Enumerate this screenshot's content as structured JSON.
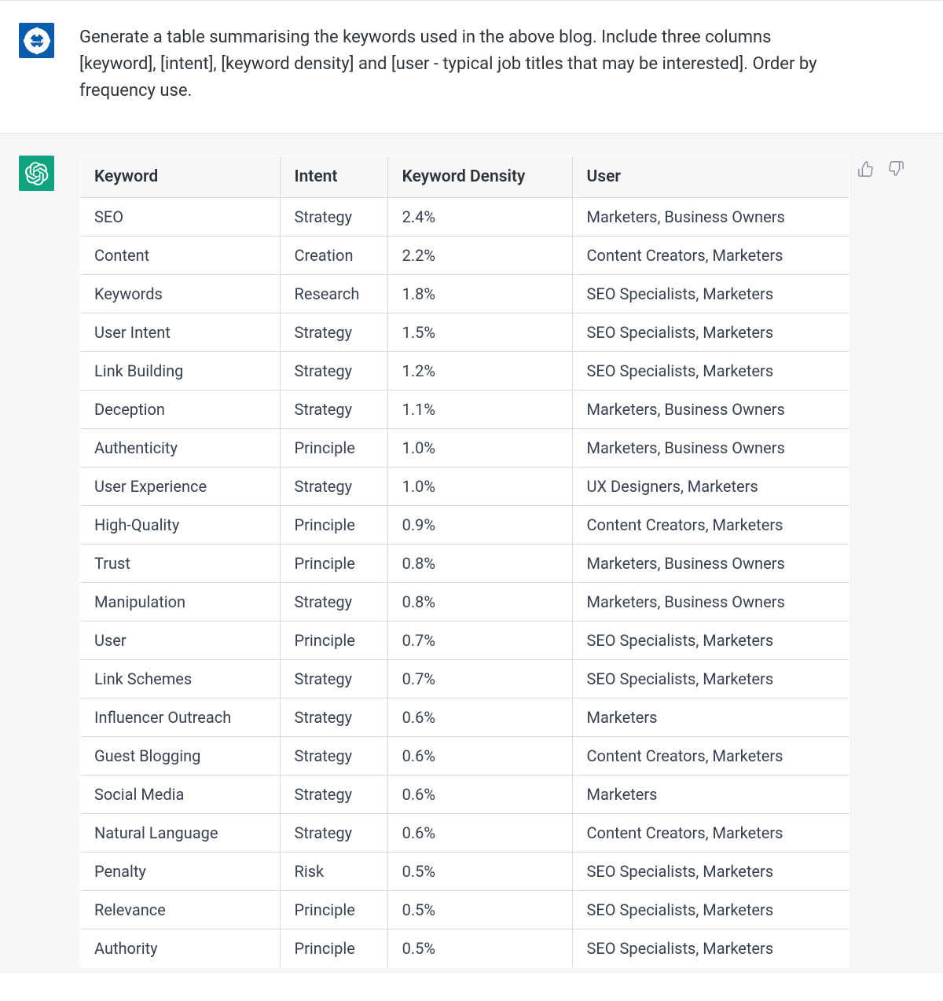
{
  "user": {
    "prompt": "Generate a table summarising the keywords used in the above blog. Include three columns [keyword], [intent], [keyword density] and [user - typical job titles that may be interested]. Order by frequency use."
  },
  "table": {
    "headers": {
      "keyword": "Keyword",
      "intent": "Intent",
      "density": "Keyword Density",
      "user": "User"
    },
    "rows": [
      {
        "keyword": "SEO",
        "intent": "Strategy",
        "density": "2.4%",
        "user": "Marketers, Business Owners"
      },
      {
        "keyword": "Content",
        "intent": "Creation",
        "density": "2.2%",
        "user": "Content Creators, Marketers"
      },
      {
        "keyword": "Keywords",
        "intent": "Research",
        "density": "1.8%",
        "user": "SEO Specialists, Marketers"
      },
      {
        "keyword": "User Intent",
        "intent": "Strategy",
        "density": "1.5%",
        "user": "SEO Specialists, Marketers"
      },
      {
        "keyword": "Link Building",
        "intent": "Strategy",
        "density": "1.2%",
        "user": "SEO Specialists, Marketers"
      },
      {
        "keyword": "Deception",
        "intent": "Strategy",
        "density": "1.1%",
        "user": "Marketers, Business Owners"
      },
      {
        "keyword": "Authenticity",
        "intent": "Principle",
        "density": "1.0%",
        "user": "Marketers, Business Owners"
      },
      {
        "keyword": "User Experience",
        "intent": "Strategy",
        "density": "1.0%",
        "user": "UX Designers, Marketers"
      },
      {
        "keyword": "High-Quality",
        "intent": "Principle",
        "density": "0.9%",
        "user": "Content Creators, Marketers"
      },
      {
        "keyword": "Trust",
        "intent": "Principle",
        "density": "0.8%",
        "user": "Marketers, Business Owners"
      },
      {
        "keyword": "Manipulation",
        "intent": "Strategy",
        "density": "0.8%",
        "user": "Marketers, Business Owners"
      },
      {
        "keyword": "User",
        "intent": "Principle",
        "density": "0.7%",
        "user": "SEO Specialists, Marketers"
      },
      {
        "keyword": "Link Schemes",
        "intent": "Strategy",
        "density": "0.7%",
        "user": "SEO Specialists, Marketers"
      },
      {
        "keyword": "Influencer Outreach",
        "intent": "Strategy",
        "density": "0.6%",
        "user": "Marketers"
      },
      {
        "keyword": "Guest Blogging",
        "intent": "Strategy",
        "density": "0.6%",
        "user": "Content Creators, Marketers"
      },
      {
        "keyword": "Social Media",
        "intent": "Strategy",
        "density": "0.6%",
        "user": "Marketers"
      },
      {
        "keyword": "Natural Language",
        "intent": "Strategy",
        "density": "0.6%",
        "user": "Content Creators, Marketers"
      },
      {
        "keyword": "Penalty",
        "intent": "Risk",
        "density": "0.5%",
        "user": "SEO Specialists, Marketers"
      },
      {
        "keyword": "Relevance",
        "intent": "Principle",
        "density": "0.5%",
        "user": "SEO Specialists, Marketers"
      },
      {
        "keyword": "Authority",
        "intent": "Principle",
        "density": "0.5%",
        "user": "SEO Specialists, Marketers"
      }
    ]
  }
}
